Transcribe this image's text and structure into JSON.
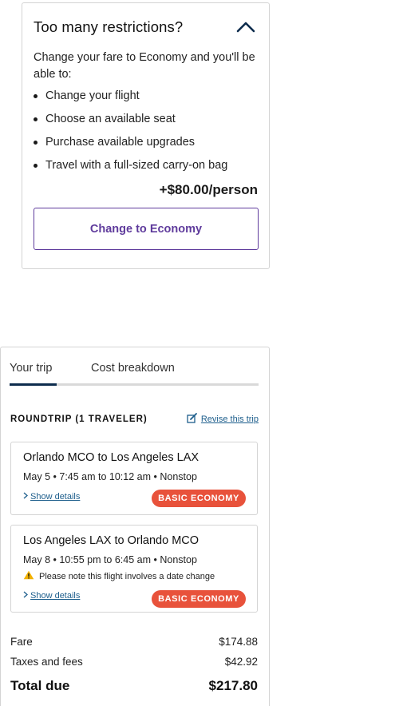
{
  "upsell": {
    "title": "Too many restrictions?",
    "intro": "Change your fare to Economy and you'll be able to:",
    "benefits": [
      "Change your flight",
      "Choose an available seat",
      "Purchase available upgrades",
      "Travel with a full-sized carry-on bag"
    ],
    "price": "+$80.00/person",
    "button_label": "Change to Economy"
  },
  "tabs": [
    {
      "label": "Your trip",
      "active": true
    },
    {
      "label": "Cost breakdown",
      "active": false
    }
  ],
  "trip": {
    "title": "ROUNDTRIP (1 TRAVELER)",
    "revise_label": "Revise this trip",
    "flights": [
      {
        "route": "Orlando MCO to Los Angeles LAX",
        "times": "May 5 • 7:45 am to 10:12 am • Nonstop",
        "details_label": "Show details",
        "fare_badge": "BASIC ECONOMY"
      },
      {
        "route": "Los Angeles LAX to Orlando MCO",
        "times": "May 8 • 10:55 pm to 6:45 am • Nonstop",
        "warning": "Please note this flight involves a date change",
        "details_label": "Show details",
        "fare_badge": "BASIC ECONOMY"
      }
    ]
  },
  "costs": {
    "fare_label": "Fare",
    "fare_value": "$174.88",
    "taxes_label": "Taxes and fees",
    "taxes_value": "$42.92",
    "total_label": "Total due",
    "total_value": "$217.80"
  },
  "colors": {
    "accent_purple": "#5f3b9c",
    "link_blue": "#1d5e8c",
    "badge_orange": "#e8523b",
    "tab_active": "#0d2c4d",
    "warning_yellow": "#f2b100"
  },
  "icons": {
    "collapse": "chevron-up-icon",
    "revise": "edit-icon",
    "details": "chevron-right-icon",
    "warning": "warning-icon"
  }
}
